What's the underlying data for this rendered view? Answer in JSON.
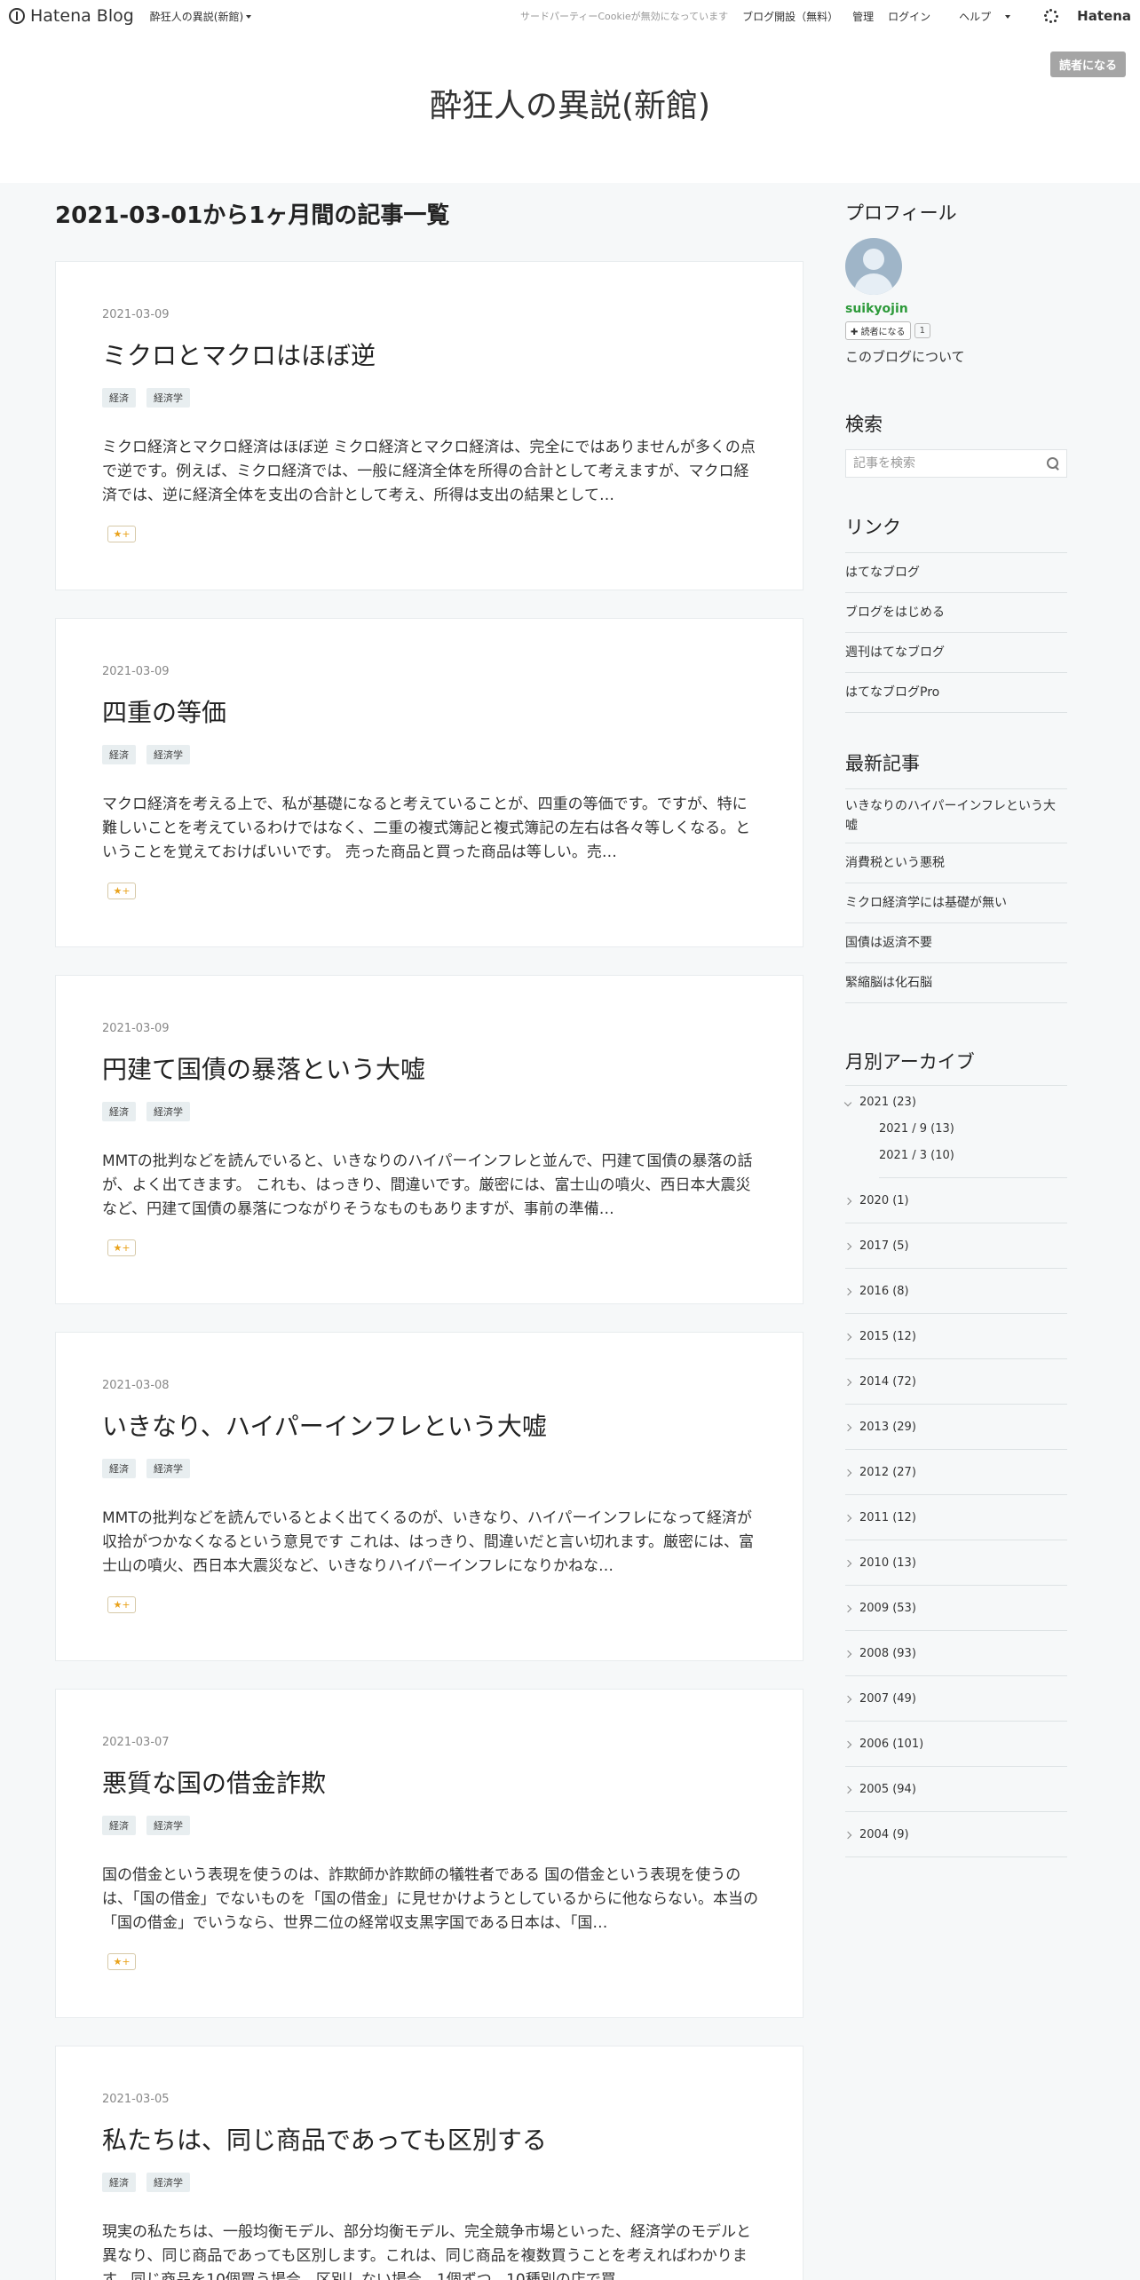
{
  "topbar": {
    "logo_text": "Hatena Blog",
    "blog_switch": "酔狂人の異説(新館)",
    "cookie_note": "サードパーティーCookieが無効になっています",
    "start_blog": "ブログ開設（無料）",
    "admin": "管理",
    "login": "ログイン",
    "help": "ヘルプ",
    "brand": "Hatena"
  },
  "header": {
    "subscribe": "読者になる",
    "title": "酔狂人の異説(新館)"
  },
  "archive_heading": "2021-03-01から1ヶ月間の記事一覧",
  "entries": [
    {
      "date": "2021-03-09",
      "title": "ミクロとマクロはほぼ逆",
      "cats": [
        "経済",
        "経済学"
      ],
      "summary": "ミクロ経済とマクロ経済はほぼ逆 ミクロ経済とマクロ経済は、完全にではありませんが多くの点で逆です。例えば、ミクロ経済では、一般に経済全体を所得の合計として考えますが、マクロ経済では、逆に経済全体を支出の合計として考え、所得は支出の結果として…",
      "star": "★+"
    },
    {
      "date": "2021-03-09",
      "title": "四重の等価",
      "cats": [
        "経済",
        "経済学"
      ],
      "summary": "マクロ経済を考える上で、私が基礎になると考えていることが、四重の等価です。ですが、特に難しいことを考えているわけではなく、二重の複式簿記と複式簿記の左右は各々等しくなる。ということを覚えておけばいいです。 売った商品と買った商品は等しい。売…",
      "star": "★+"
    },
    {
      "date": "2021-03-09",
      "title": "円建て国債の暴落という大嘘",
      "cats": [
        "経済",
        "経済学"
      ],
      "summary": "MMTの批判などを読んでいると、いきなりのハイパーインフレと並んで、円建て国債の暴落の話が、よく出てきます。 これも、はっきり、間違いです。厳密には、富士山の噴火、西日本大震災など、円建て国債の暴落につながりそうなものもありますが、事前の準備…",
      "star": "★+"
    },
    {
      "date": "2021-03-08",
      "title": "いきなり、ハイパーインフレという大嘘",
      "cats": [
        "経済",
        "経済学"
      ],
      "summary": "MMTの批判などを読んでいるとよく出てくるのが、いきなり、ハイパーインフレになって経済が収拾がつかなくなるという意見です これは、はっきり、間違いだと言い切れます。厳密には、富士山の噴火、西日本大震災など、いきなりハイパーインフレになりかねな…",
      "star": "★+"
    },
    {
      "date": "2021-03-07",
      "title": "悪質な国の借金詐欺",
      "cats": [
        "経済",
        "経済学"
      ],
      "summary": "国の借金という表現を使うのは、詐欺師か詐欺師の犠牲者である 国の借金という表現を使うのは、「国の借金」でないものを「国の借金」に見せかけようとしているからに他ならない。本当の「国の借金」でいうなら、世界二位の経常収支黒字国である日本は、「国…",
      "star": "★+"
    },
    {
      "date": "2021-03-05",
      "title": "私たちは、同じ商品であっても区別する",
      "cats": [
        "経済",
        "経済学"
      ],
      "summary": "現実の私たちは、一般均衡モデル、部分均衡モデル、完全競争市場といった、経済学のモデルと異なり、同じ商品であっても区別します。これは、同じ商品を複数買うことを考えればわかります。同じ商品を10個買う場合、区別しない場合、1個ずつ、10種別の店で買…",
      "star": "★+"
    }
  ],
  "sidebar": {
    "profile": {
      "title": "プロフィール",
      "name": "suikyojin",
      "subscribe": "読者になる",
      "count": "1",
      "about": "このブログについて"
    },
    "search": {
      "title": "検索",
      "placeholder": "記事を検索"
    },
    "links": {
      "title": "リンク",
      "items": [
        "はてなブログ",
        "ブログをはじめる",
        "週刊はてなブログ",
        "はてなブログPro"
      ]
    },
    "recent": {
      "title": "最新記事",
      "items": [
        "いきなりのハイパーインフレという大嘘",
        "消費税という悪税",
        "ミクロ経済学には基礎が無い",
        "国債は返済不要",
        "緊縮脳は化石脳"
      ]
    },
    "archive": {
      "title": "月別アーカイブ",
      "open_year": "2021 (23)",
      "months": [
        "2021 / 9 (13)",
        "2021 / 3 (10)"
      ],
      "years": [
        "2020 (1)",
        "2017 (5)",
        "2016 (8)",
        "2015 (12)",
        "2014 (72)",
        "2013 (29)",
        "2012 (27)",
        "2011 (12)",
        "2010 (13)",
        "2009 (53)",
        "2008 (93)",
        "2007 (49)",
        "2006 (101)",
        "2005 (94)",
        "2004 (9)"
      ]
    }
  }
}
